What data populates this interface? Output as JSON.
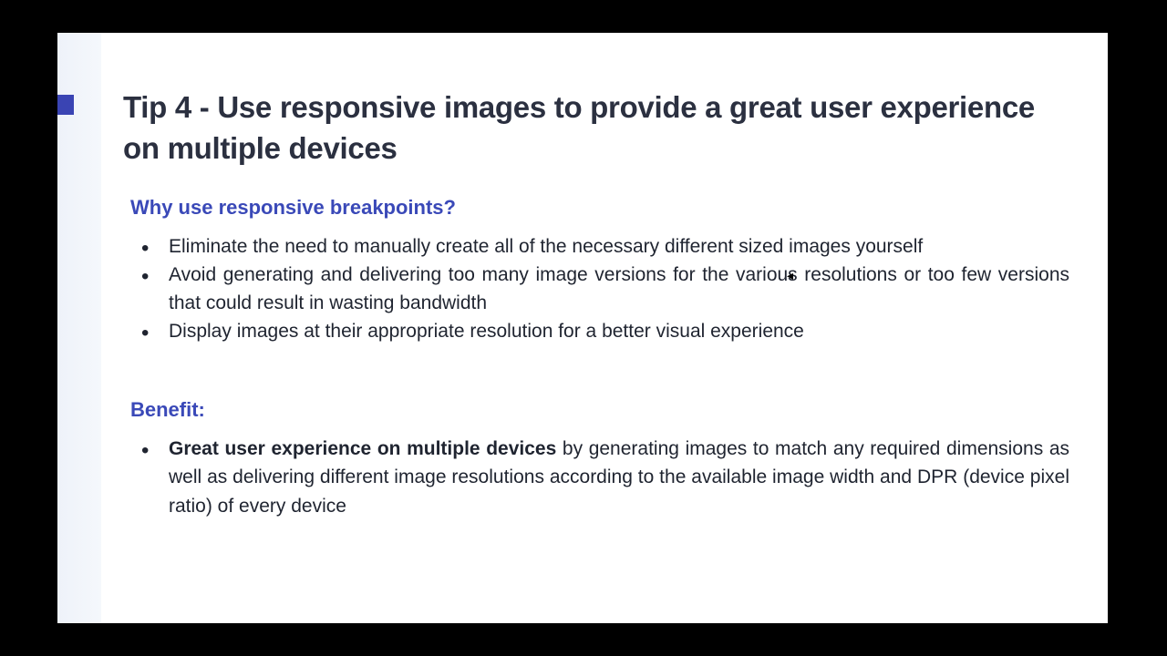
{
  "slide": {
    "title": "Tip 4 - Use responsive images to provide a great user experience on multiple devices",
    "section1": {
      "heading": "Why use responsive breakpoints?",
      "bullets": [
        "Eliminate the need to manually create all of the necessary different sized images yourself",
        "Avoid generating and delivering too many image versions for the various resolutions or too few versions that could result in wasting bandwidth",
        "Display images at their appropriate resolution for a better visual experience"
      ]
    },
    "section2": {
      "heading": "Benefit:",
      "bullet_strong": "Great user experience on multiple devices",
      "bullet_rest": " by generating images to match any required dimensions as well as delivering different image resolutions according to the available image width and DPR (device pixel ratio) of  every device"
    }
  }
}
